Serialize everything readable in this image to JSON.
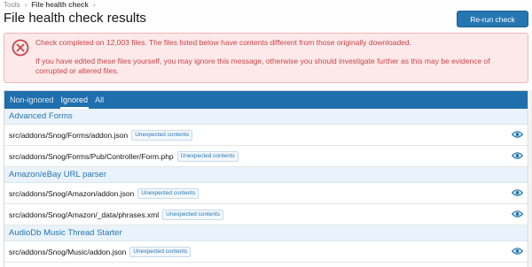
{
  "breadcrumb": {
    "items": [
      "Tools",
      "File health check"
    ]
  },
  "page_title": "File health check results",
  "rerun_button": "Re-run check",
  "alert": {
    "line1": "Check completed on 12,003 files. The files listed below have contents different from those originally downloaded.",
    "line2": "If you have edited these files yourself, you may ignore this message, otherwise you should investigate further as this may be evidence of corrupted or altered files."
  },
  "tabs": [
    {
      "label": "Non-ignored",
      "active": false
    },
    {
      "label": "Ignored",
      "active": true
    },
    {
      "label": "All",
      "active": false
    }
  ],
  "groups": [
    {
      "title": "Advanced Forms",
      "files": [
        {
          "path": "src/addons/Snog/Forms/addon.json",
          "badge": "Unexpected contents"
        },
        {
          "path": "src/addons/Snog/Forms/Pub/Controller/Form.php",
          "badge": "Unexpected contents"
        }
      ]
    },
    {
      "title": "Amazon/eBay URL parser",
      "files": [
        {
          "path": "src/addons/Snog/Amazon/addon.json",
          "badge": "Unexpected contents"
        },
        {
          "path": "src/addons/Snog/Amazon/_data/phrases.xml",
          "badge": "Unexpected contents"
        }
      ]
    },
    {
      "title": "AudioDb Music Thread Starter",
      "files": [
        {
          "path": "src/addons/Snog/Music/addon.json",
          "badge": "Unexpected contents"
        }
      ]
    }
  ],
  "colors": {
    "accent": "#2577b1",
    "alert_text": "#c84448",
    "alert_bg": "#fde9e9",
    "tab_bar": "#1f6fad"
  },
  "icons": {
    "alert": "x-circle-icon",
    "view": "eye-icon",
    "separator": "chevron-right-icon"
  }
}
